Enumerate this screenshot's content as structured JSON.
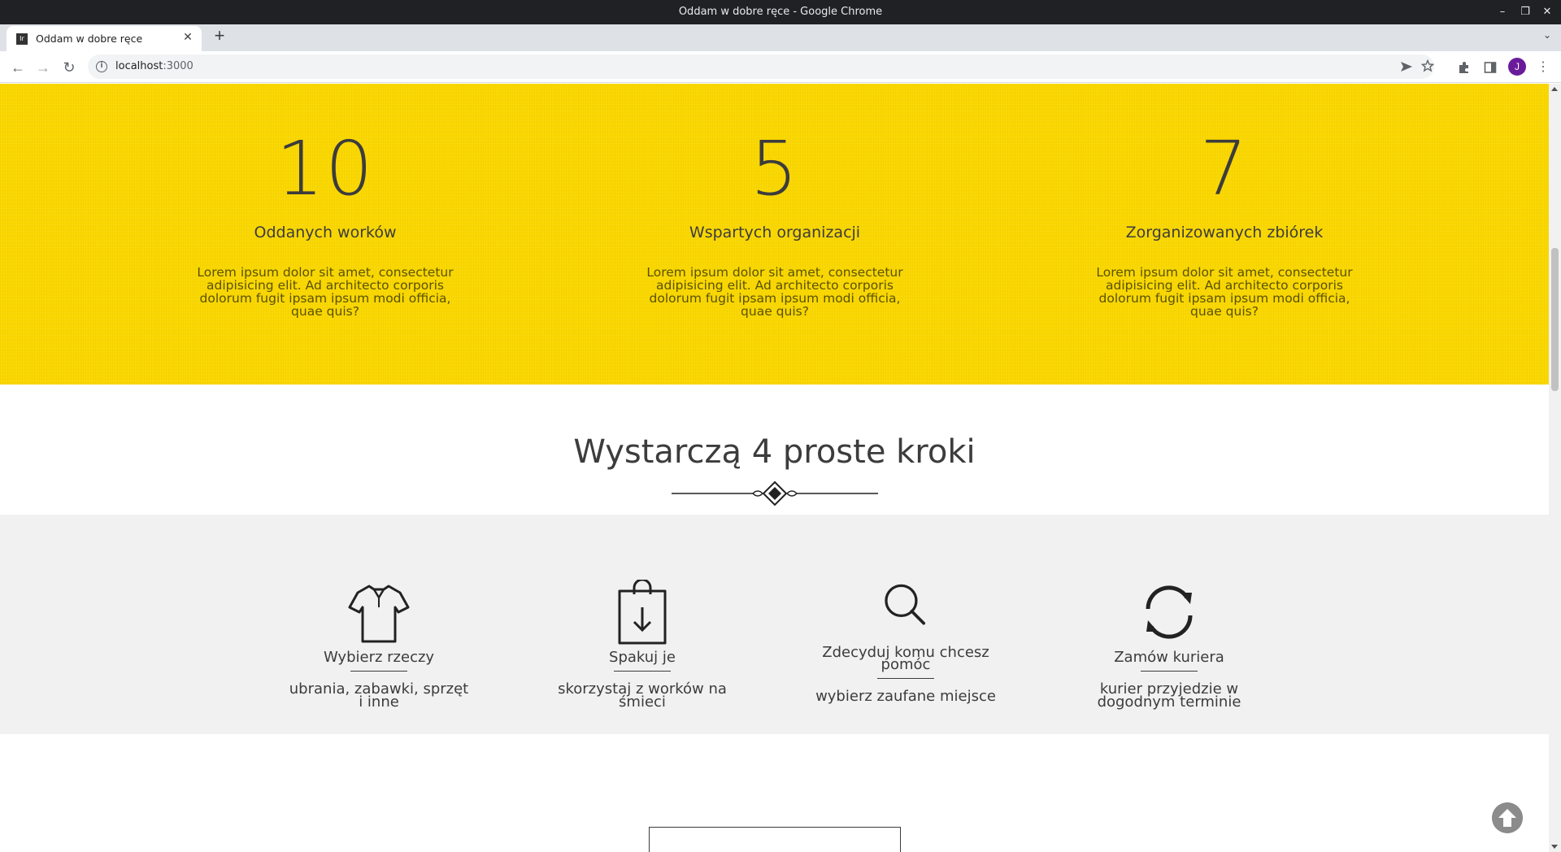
{
  "browser": {
    "window_title": "Oddam w dobre ręce - Google Chrome",
    "tab_title": "Oddam w dobre ręce",
    "favicon_text": "Ir",
    "url_host": "localhost",
    "url_port": ":3000",
    "avatar_letter": "J"
  },
  "stats": [
    {
      "number": "10",
      "label": "Oddanych worków",
      "description": "Lorem ipsum dolor sit amet, consectetur adipisicing elit. Ad architecto corporis dolorum fugit ipsam ipsum modi officia, quae quis?"
    },
    {
      "number": "5",
      "label": "Wspartych organizacji",
      "description": "Lorem ipsum dolor sit amet, consectetur adipisicing elit. Ad architecto corporis dolorum fugit ipsam ipsum modi officia, quae quis?"
    },
    {
      "number": "7",
      "label": "Zorganizowanych zbiórek",
      "description": "Lorem ipsum dolor sit amet, consectetur adipisicing elit. Ad architecto corporis dolorum fugit ipsam ipsum modi officia, quae quis?"
    }
  ],
  "steps_section": {
    "heading": "Wystarczą 4 proste kroki",
    "steps": [
      {
        "icon": "tshirt-icon",
        "title": "Wybierz rzeczy",
        "description": "ubrania, zabawki, sprzęt i inne"
      },
      {
        "icon": "shopping-bag-icon",
        "title": "Spakuj je",
        "description": "skorzystaj z worków na śmieci"
      },
      {
        "icon": "search-icon",
        "title": "Zdecyduj komu chcesz pomóc",
        "description": "wybierz zaufane miejsce"
      },
      {
        "icon": "refresh-icon",
        "title": "Zamów kuriera",
        "description": "kurier przyjedzie w dogodnym terminie"
      }
    ]
  },
  "colors": {
    "stats_background": "#fad700",
    "steps_background": "#f0f1f0",
    "text": "#3c3c3c"
  }
}
